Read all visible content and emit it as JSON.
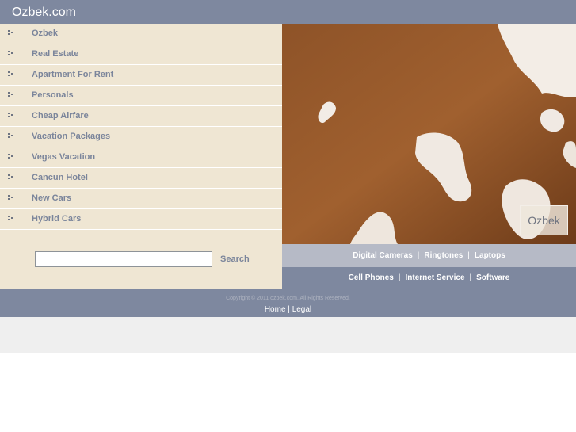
{
  "header": {
    "title": "Ozbek.com"
  },
  "sidebar": {
    "items": [
      {
        "label": "Ozbek"
      },
      {
        "label": "Real Estate"
      },
      {
        "label": "Apartment For Rent"
      },
      {
        "label": "Personals"
      },
      {
        "label": "Cheap Airfare"
      },
      {
        "label": "Vacation Packages"
      },
      {
        "label": "Vegas Vacation"
      },
      {
        "label": "Cancun Hotel"
      },
      {
        "label": "New Cars"
      },
      {
        "label": "Hybrid Cars"
      }
    ]
  },
  "search": {
    "value": "",
    "button_label": "Search"
  },
  "hero": {
    "badge": "Ozbek"
  },
  "links": {
    "row1": [
      "Digital Cameras",
      "Ringtones",
      "Laptops"
    ],
    "row2": [
      "Cell Phones",
      "Internet Service",
      "Software"
    ],
    "separator": "|"
  },
  "footer": {
    "copyright": "Copyright © 2011 ozbek.com. All Rights Reserved.",
    "home": "Home",
    "separator": "|",
    "legal": "Legal"
  },
  "colors": {
    "header_bg": "#7e889f",
    "sidebar_bg": "#efe6d3",
    "link_text": "#7b859b",
    "links_row1_bg": "#b6bac6",
    "bottom_band": "#efefef"
  }
}
